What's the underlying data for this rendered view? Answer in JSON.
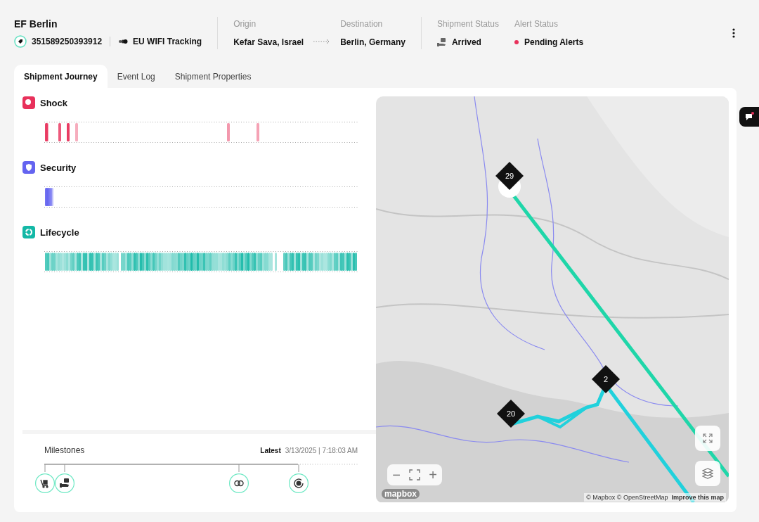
{
  "shipment": {
    "title": "EF Berlin",
    "device_id": "351589250393912",
    "tracking": "EU WIFI Tracking"
  },
  "route": {
    "origin_label": "Origin",
    "origin": "Kefar Sava, Israel",
    "destination_label": "Destination",
    "destination": "Berlin, Germany"
  },
  "status": {
    "shipment_label": "Shipment Status",
    "shipment": "Arrived",
    "alert_label": "Alert Status",
    "alert": "Pending Alerts"
  },
  "tabs": [
    {
      "label": "Shipment Journey",
      "selected": true
    },
    {
      "label": "Event Log",
      "selected": false
    },
    {
      "label": "Shipment Properties",
      "selected": false
    }
  ],
  "sensors": [
    {
      "name": "Shock",
      "kind": "shock"
    },
    {
      "name": "Security",
      "kind": "security"
    },
    {
      "name": "Lifecycle",
      "kind": "lifecycle"
    }
  ],
  "milestones": {
    "title": "Milestones",
    "latest_label": "Latest",
    "latest": "3/13/2025 | 7:18:03 AM",
    "items": [
      {
        "kind": "cart"
      },
      {
        "kind": "hand"
      },
      {
        "kind": "link"
      },
      {
        "kind": "sync"
      }
    ]
  },
  "map": {
    "clusters": [
      {
        "label": "29"
      },
      {
        "label": "2"
      },
      {
        "label": "20"
      }
    ],
    "zoom_out": "−",
    "zoom_in": "+",
    "logo": "mapbox",
    "attribution": "© Mapbox © OpenStreetMap",
    "improve": "Improve this map"
  }
}
